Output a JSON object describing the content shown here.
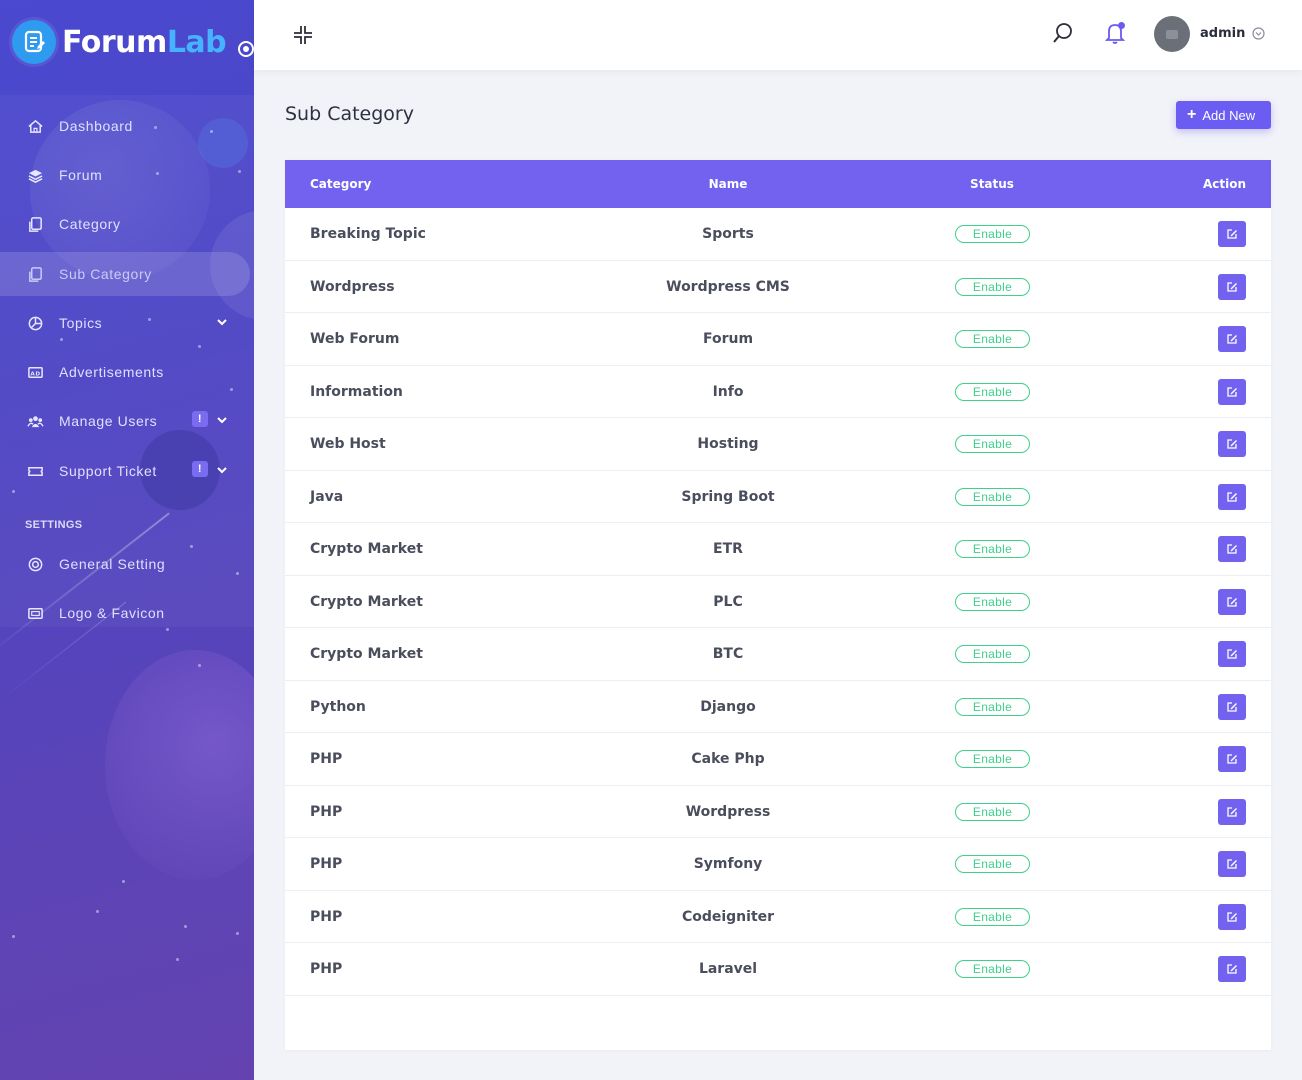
{
  "brand": {
    "name_part1": "Forum",
    "name_part2": "Lab"
  },
  "sidebar": {
    "items": [
      {
        "label": "Dashboard",
        "icon": "home-icon"
      },
      {
        "label": "Forum",
        "icon": "layers-icon"
      },
      {
        "label": "Category",
        "icon": "category-icon"
      },
      {
        "label": "Sub Category",
        "icon": "subcategory-icon",
        "active": true
      },
      {
        "label": "Topics",
        "icon": "topics-icon",
        "has_submenu": true
      },
      {
        "label": "Advertisements",
        "icon": "advertisement-icon"
      },
      {
        "label": "Manage Users",
        "icon": "users-icon",
        "has_submenu": true,
        "badge": "!"
      },
      {
        "label": "Support Ticket",
        "icon": "ticket-icon",
        "has_submenu": true,
        "badge": "!"
      }
    ],
    "settings_label": "SETTINGS",
    "settings_items": [
      {
        "label": "General Setting",
        "icon": "settings-icon"
      },
      {
        "label": "Logo & Favicon",
        "icon": "image-icon"
      }
    ]
  },
  "topbar": {
    "username": "admin",
    "icons": [
      "collapse-icon",
      "search-icon",
      "bell-icon",
      "avatar",
      "chevron-down-icon"
    ]
  },
  "page": {
    "title": "Sub Category",
    "add_button_label": "Add New"
  },
  "table": {
    "headers": {
      "category": "Category",
      "name": "Name",
      "status": "Status",
      "action": "Action"
    },
    "rows": [
      {
        "category": "Breaking Topic",
        "name": "Sports",
        "status": "Enable"
      },
      {
        "category": "Wordpress",
        "name": "Wordpress CMS",
        "status": "Enable"
      },
      {
        "category": "Web Forum",
        "name": "Forum",
        "status": "Enable"
      },
      {
        "category": "Information",
        "name": "Info",
        "status": "Enable"
      },
      {
        "category": "Web Host",
        "name": "Hosting",
        "status": "Enable"
      },
      {
        "category": "Java",
        "name": "Spring Boot",
        "status": "Enable"
      },
      {
        "category": "Crypto Market",
        "name": "ETR",
        "status": "Enable"
      },
      {
        "category": "Crypto Market",
        "name": "PLC",
        "status": "Enable"
      },
      {
        "category": "Crypto Market",
        "name": "BTC",
        "status": "Enable"
      },
      {
        "category": "Python",
        "name": "Django",
        "status": "Enable"
      },
      {
        "category": "PHP",
        "name": "Cake Php",
        "status": "Enable"
      },
      {
        "category": "PHP",
        "name": "Wordpress",
        "status": "Enable"
      },
      {
        "category": "PHP",
        "name": "Symfony",
        "status": "Enable"
      },
      {
        "category": "PHP",
        "name": "Codeigniter",
        "status": "Enable"
      },
      {
        "category": "PHP",
        "name": "Laravel",
        "status": "Enable"
      }
    ]
  },
  "colors": {
    "accent": "#7262ef",
    "status_enabled": "#3fd08a",
    "sidebar_bg": "#4d44c4",
    "logo_blue": "#2f9bf0"
  }
}
